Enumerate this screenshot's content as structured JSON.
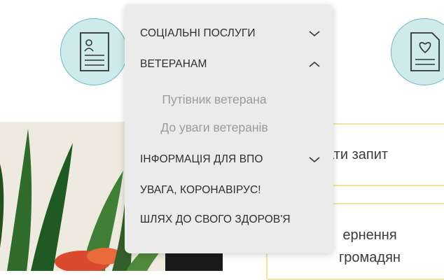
{
  "menu": {
    "items": [
      {
        "label": "СОЦІАЛЬНІ ПОСЛУГИ",
        "chevron": "chevron-down-icon"
      },
      {
        "label": "ВЕТЕРАНАМ",
        "chevron": "chevron-up-icon"
      },
      {
        "label": "ІНФОРМАЦІЯ ДЛЯ ВПО",
        "chevron": "chevron-down-icon"
      },
      {
        "label": "УВАГА, КОРОНАВІРУС!"
      },
      {
        "label": "ШЛЯХ ДО СВОГО ЗДОРОВ'Я"
      }
    ],
    "veterans_submenu": [
      "Путівник ветерана",
      "До уваги ветеранів"
    ]
  },
  "cards": {
    "request": "ати запит",
    "appeals_line1": "ернення",
    "appeals_line2": "громадян"
  },
  "icons": {
    "left_circle": "person-document-icon",
    "right_circle": "heart-document-icon"
  },
  "colors": {
    "circle_fill": "#cfeaec",
    "circle_border": "#6fb9bf",
    "card_border": "#f6e3a3",
    "menu_bg": "#ebebeb",
    "submenu_text": "#9a9a9a"
  }
}
